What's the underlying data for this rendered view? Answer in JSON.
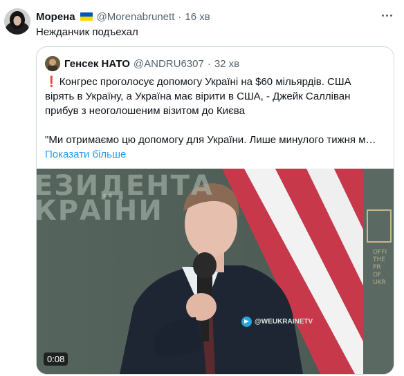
{
  "post": {
    "author_name": "Морена",
    "author_handle": "@Morenabrunett",
    "separator": "·",
    "time": "16 хв",
    "text": "Нежданчик подъехал"
  },
  "quote": {
    "author_name": "Генсек НАТО",
    "author_handle": "@ANDRU6307",
    "separator": "·",
    "time": "32 хв",
    "lines": [
      "Конгрес проголосує допомогу Україні на $60 мільярдів. США",
      "вірять в Україну, а Україна має вірити в США, - Джейк Салліван",
      "прибув з неоголошеним візитом до Києва"
    ],
    "exclamation": "❗",
    "line_after_gap": "\"Ми отримаємо цю допомогу для України. Лише минулого тижня м…",
    "show_more": "Показати більше",
    "media": {
      "backdrop_text_1": "ЕЗИДЕНТА",
      "backdrop_text_2": "КРАЇНИ",
      "side_text_1": "OFFI",
      "side_text_2": "THE PR",
      "side_text_3": "OF UKR",
      "watermark": "@WEUKRAINETV",
      "duration": "0:08"
    }
  },
  "colors": {
    "link": "#1d9bf0",
    "secondary_text": "#536471",
    "border": "#cfd9de",
    "flag_blue": "#0057b7",
    "flag_yellow": "#ffd700"
  }
}
